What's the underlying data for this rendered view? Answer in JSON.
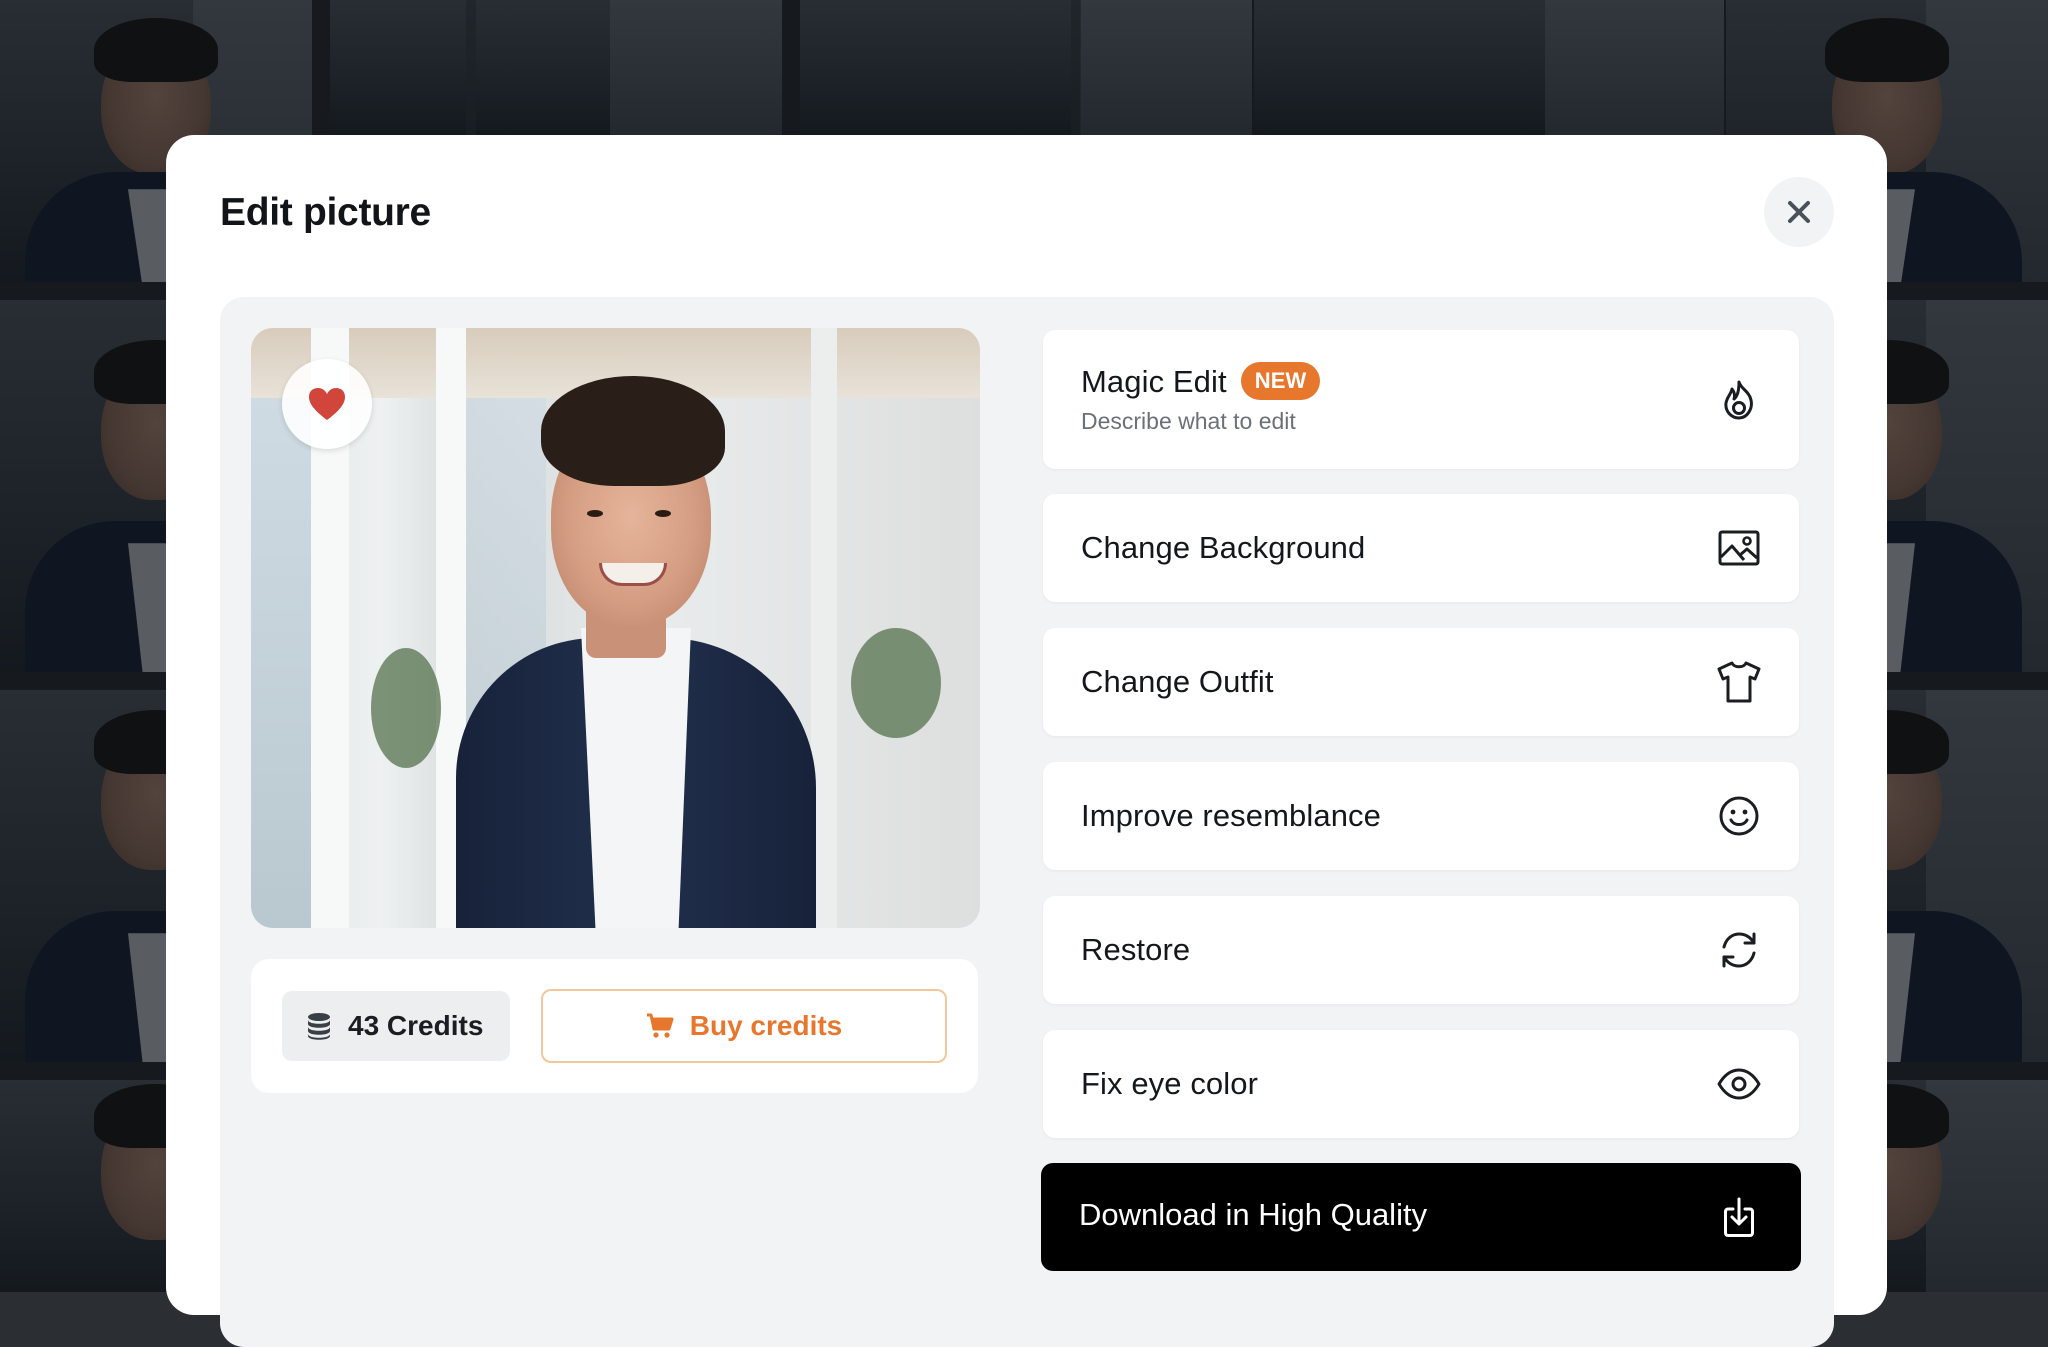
{
  "modal": {
    "title": "Edit picture"
  },
  "credits": {
    "label": "43 Credits",
    "buy_label": "Buy credits"
  },
  "options": [
    {
      "label": "Magic Edit",
      "badge": "NEW",
      "subtitle": "Describe what to edit",
      "icon": "flame-icon"
    },
    {
      "label": "Change Background",
      "icon": "image-icon"
    },
    {
      "label": "Change Outfit",
      "icon": "tshirt-icon"
    },
    {
      "label": "Improve resemblance",
      "icon": "smiley-icon"
    },
    {
      "label": "Restore",
      "icon": "refresh-icon"
    },
    {
      "label": "Fix eye color",
      "icon": "eye-icon"
    }
  ],
  "download": {
    "label": "Download in High Quality",
    "icon": "download-icon"
  },
  "colors": {
    "accent": "#e8772e",
    "heart": "#d1453b",
    "primary_button": "#000000",
    "panel_bg": "#f2f3f5"
  }
}
